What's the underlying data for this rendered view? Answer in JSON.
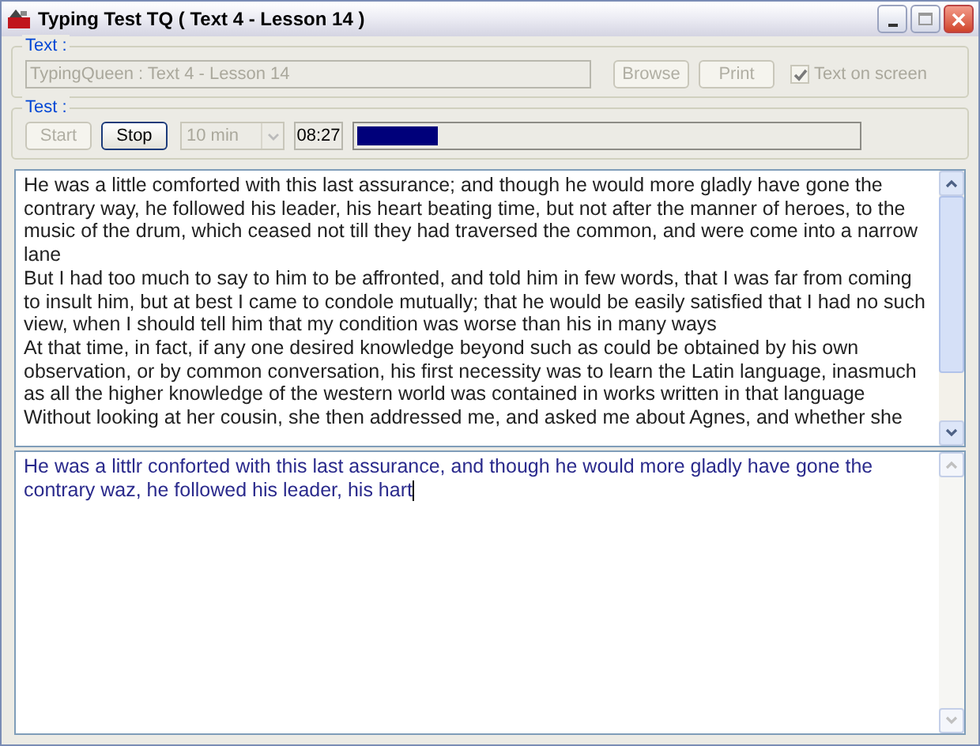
{
  "window": {
    "title": "Typing Test TQ ( Text 4 - Lesson 14 )"
  },
  "text_group": {
    "label": "Text :",
    "source": {
      "value": "TypingQueen : Text 4 - Lesson 14",
      "disabled": true
    },
    "buttons": [
      {
        "label": "Browse",
        "disabled": true
      },
      {
        "label": "Print",
        "disabled": true
      }
    ],
    "text_on_screen": {
      "label": "Text on screen",
      "checked": true,
      "disabled": true
    }
  },
  "test_group": {
    "label": "Test :",
    "buttons": [
      {
        "label": "Start",
        "disabled": true
      },
      {
        "label": "Stop",
        "disabled": false
      }
    ],
    "duration": {
      "value": "10 min",
      "disabled": true
    },
    "timer": "08:27",
    "progress": {
      "level": 0.16
    }
  },
  "source_text": [
    "He was a little comforted with this last assurance; and though he would more gladly have gone the contrary way, he followed his leader, his heart beating time, but not after the manner of heroes, to the music of the drum, which ceased not till they had traversed the common, and were come into a narrow lane",
    "But I had too much to say to him to be affronted, and told him in few words, that I was far from coming to insult him, but at best I came to condole mutually; that he would be easily satisfied that I had no such view, when I should tell him that my condition was worse than his in many ways",
    "At that time, in fact, if any one desired knowledge beyond such as could be obtained by his own observation, or by common conversation, his first necessity was to learn the Latin language, inasmuch as all the higher knowledge of the western world was contained in works written in that language",
    "Without looking at her cousin, she then addressed me, and asked me about Agnes, and whether she"
  ],
  "typed_text": "He was a littlr conforted with this last assurance, and though he would more gladly have gone the contrary waz, he followed his leader, his hart"
}
